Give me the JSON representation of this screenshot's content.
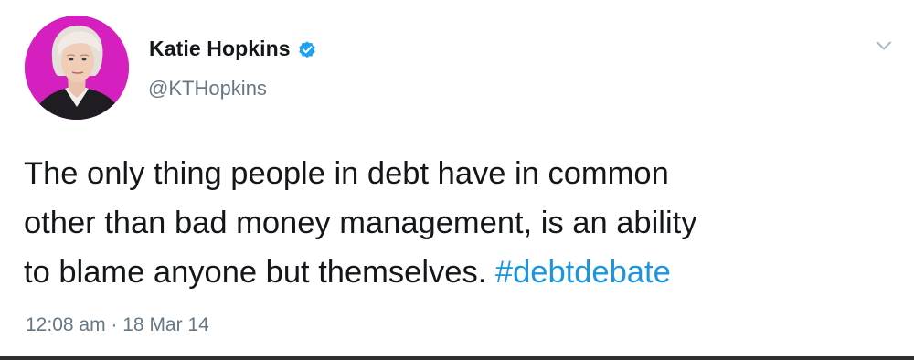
{
  "tweet": {
    "author": {
      "display_name": "Katie Hopkins",
      "handle": "@KTHopkins",
      "verified": true,
      "avatar_icon": "profile-photo",
      "avatar_bg_color": "#d61fbf"
    },
    "text_lines": [
      "The only thing people in debt have in common",
      "other than bad money management, is an ability",
      "to blame anyone but themselves."
    ],
    "hashtag": "#debtdebate",
    "timestamp": {
      "time": "12:08 am",
      "separator": "·",
      "date": "18 Mar 14"
    },
    "menu_icon": "chevron-down-icon",
    "verified_icon": "verified-badge-icon"
  },
  "colors": {
    "text_primary": "#14171a",
    "text_secondary": "#657786",
    "link": "#1b95e0",
    "verified": "#1da1f2"
  }
}
